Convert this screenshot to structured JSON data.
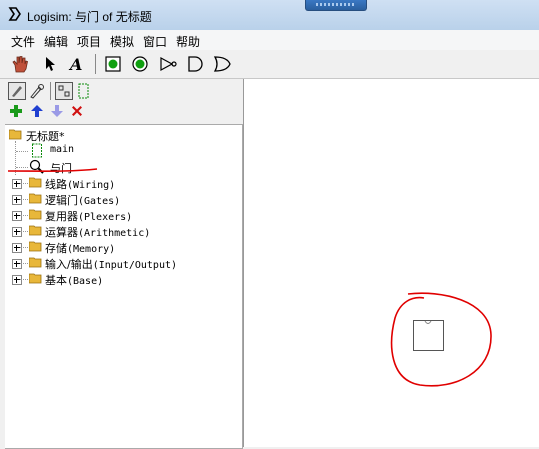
{
  "window": {
    "title": "Logisim: 与门 of 无标题"
  },
  "menu": [
    "文件",
    "编辑",
    "项目",
    "模拟",
    "窗口",
    "帮助"
  ],
  "toolbar": {
    "tools": [
      "hand-poke-icon",
      "arrow-select-icon",
      "text-tool-icon",
      "input-pin-icon",
      "output-pin-icon",
      "not-gate-icon",
      "and-gate-icon",
      "or-gate-icon"
    ],
    "aux_tools": [
      "edit-layout-icon",
      "edit-appearance-icon",
      "layout-view-icon",
      "appearance-view-icon"
    ],
    "project_tools": [
      "add-circuit-icon",
      "move-up-icon",
      "move-down-icon",
      "delete-circuit-icon"
    ]
  },
  "tree": {
    "root": "无标题*",
    "circuits": [
      "main",
      "与门"
    ],
    "libraries": [
      {
        "name": "线路",
        "en": "(Wiring)"
      },
      {
        "name": "逻辑门",
        "en": "(Gates)"
      },
      {
        "name": "复用器",
        "en": "(Plexers)"
      },
      {
        "name": "运算器",
        "en": "(Arithmetic)"
      },
      {
        "name": "存储",
        "en": "(Memory)"
      },
      {
        "name": "输入/输出",
        "en": "(Input/Output)"
      },
      {
        "name": "基本",
        "en": "(Base)"
      }
    ]
  },
  "colors": {
    "annotation": "#e00000",
    "add": "#1a9a1a",
    "up": "#1f3fd0",
    "down": "#8888dd",
    "delete": "#d01010",
    "pin": "#0a8a0a"
  }
}
